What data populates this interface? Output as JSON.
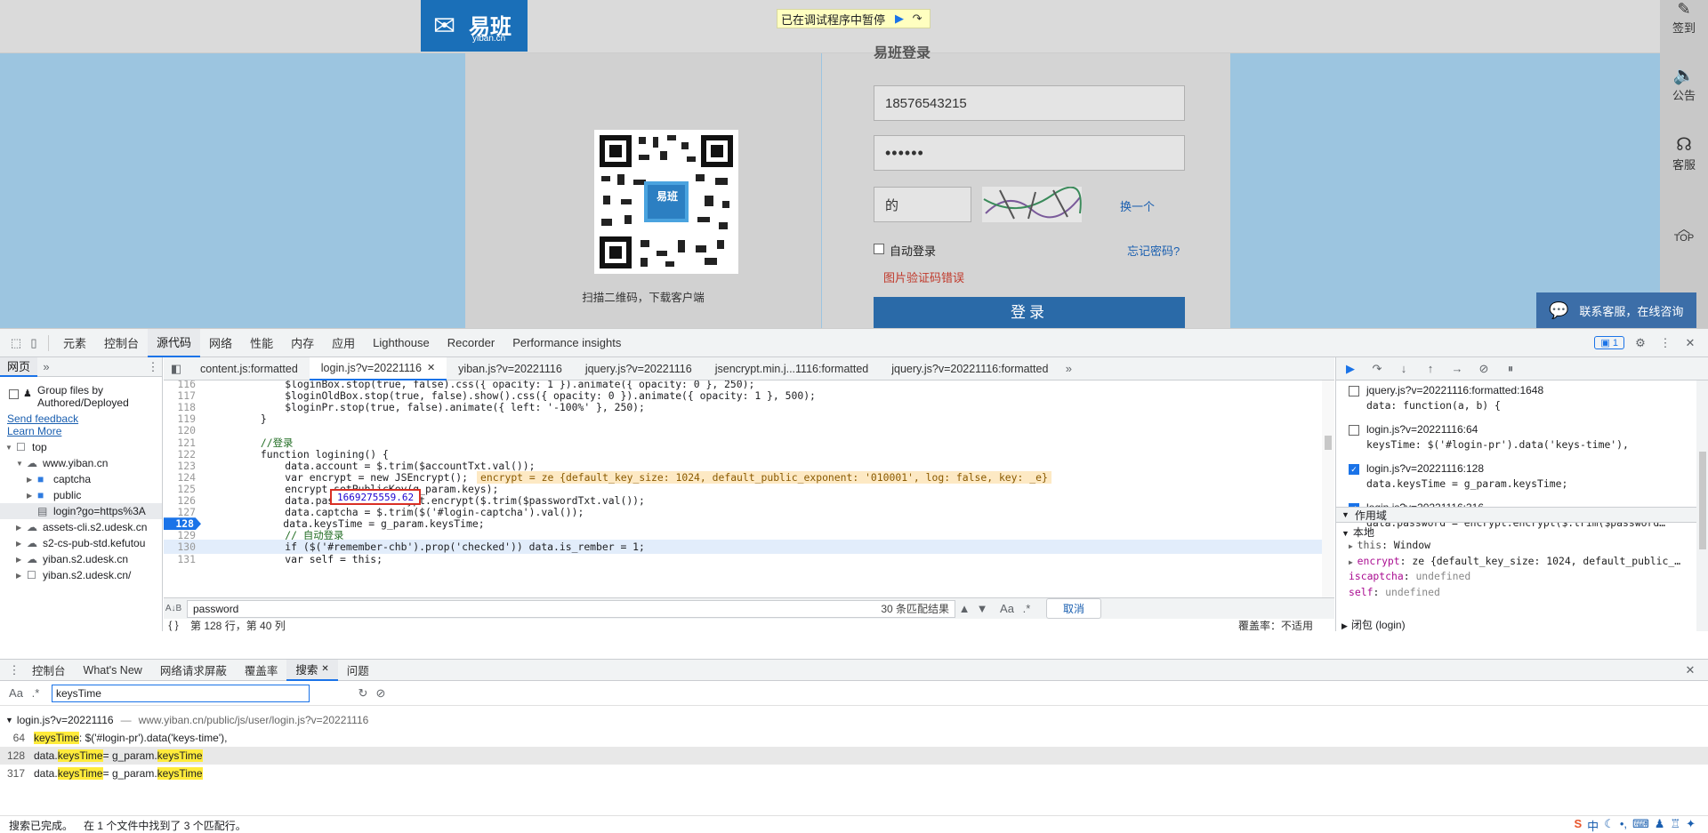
{
  "page": {
    "logo_text": "易班",
    "logo_subtext": "yiban.cn",
    "pause_banner": "已在调试程序中暂停",
    "heading_partial": "易班登录",
    "qr_caption": "扫描二维码，下载客户端",
    "qr_badge": "易班",
    "phone_value": "18576543215",
    "password_value": "••••••",
    "captcha_value": "的",
    "captcha_refresh": "换一个",
    "remember_label": "自动登录",
    "forgot_link": "忘记密码?",
    "error_text": "图片验证码错误",
    "login_button": "登录",
    "rail": {
      "signin": "签到",
      "announce": "公告",
      "service": "客服",
      "top": "TOP"
    },
    "chat_widget": "联系客服，在线咨询"
  },
  "devtools": {
    "main_tabs": [
      "元素",
      "控制台",
      "源代码",
      "网络",
      "性能",
      "内存",
      "应用",
      "Lighthouse",
      "Recorder",
      "Performance insights"
    ],
    "active_main_tab": "源代码",
    "issues_count": "1",
    "nav_tabs": {
      "page": "网页"
    },
    "nav_group_label": "Group files by Authored/Deployed",
    "send_feedback": "Send feedback",
    "learn_more": "Learn More",
    "tree": [
      {
        "label": "top",
        "indent": 0,
        "icon": "frame"
      },
      {
        "label": "www.yiban.cn",
        "indent": 1,
        "icon": "cloud"
      },
      {
        "label": "captcha",
        "indent": 2,
        "icon": "folder"
      },
      {
        "label": "public",
        "indent": 2,
        "icon": "folder"
      },
      {
        "label": "login?go=https%3A",
        "indent": 2,
        "icon": "file"
      },
      {
        "label": "assets-cli.s2.udesk.cn",
        "indent": 1,
        "icon": "cloud"
      },
      {
        "label": "s2-cs-pub-std.kefutou",
        "indent": 1,
        "icon": "cloud"
      },
      {
        "label": "yiban.s2.udesk.cn",
        "indent": 1,
        "icon": "cloud"
      },
      {
        "label": "yiban.s2.udesk.cn/",
        "indent": 1,
        "icon": "frame"
      }
    ],
    "file_tabs": [
      "content.js:formatted",
      "login.js?v=20221116",
      "yiban.js?v=20221116",
      "jquery.js?v=20221116",
      "jsencrypt.min.j...1116:formatted",
      "jquery.js?v=20221116:formatted"
    ],
    "active_file_tab": "login.js?v=20221116",
    "code_lines": [
      {
        "n": "116",
        "t": "            $loginBox.stop(true, false).css({ opacity: 1 }).animate({ opacity: 0 }, 250);"
      },
      {
        "n": "117",
        "t": "            $loginOldBox.stop(true, false).show().css({ opacity: 0 }).animate({ opacity: 1 }, 500);"
      },
      {
        "n": "118",
        "t": "            $loginPr.stop(true, false).animate({ left: '-100%' }, 250);"
      },
      {
        "n": "119",
        "t": "        }"
      },
      {
        "n": "120",
        "t": ""
      },
      {
        "n": "121",
        "t": "        //登录"
      },
      {
        "n": "122",
        "t": "        function logining() {"
      },
      {
        "n": "123",
        "t": "            data.account = $.trim($accountTxt.val());"
      },
      {
        "n": "124",
        "t": "            var encrypt = new JSEncrypt();"
      },
      {
        "n": "125",
        "t": "            encrypt.setPublicKey(g_param.keys);"
      },
      {
        "n": "126",
        "t": "            data.password = encrypt.encrypt($.trim($passwordTxt.val());"
      },
      {
        "n": "127",
        "t": "            data.captcha = $.trim($('#login-captcha').val());"
      },
      {
        "n": "128",
        "t": "            data.keysTime = g_param.keysTime;"
      },
      {
        "n": "129",
        "t": "            // 自动登录"
      },
      {
        "n": "130",
        "t": "            if ($('#remember-chb').prop('checked')) data.is_rember = 1;"
      },
      {
        "n": "131",
        "t": "            var self = this;"
      }
    ],
    "inline_value_124": "encrypt = ze {default_key_size: 1024, default_public_exponent: '010001', log: false, key: _e}",
    "hover_value": "1669275559.62",
    "search_query": "password",
    "search_count": "30 条匹配结果",
    "search_cancel": "取消",
    "cursor_pos": "第 128 行，第 40 列",
    "coverage": "覆盖率：不适用",
    "breakpoints": [
      {
        "file": "jquery.js?v=20221116:formatted:1648",
        "code": "data: function(a, b) {",
        "checked": false
      },
      {
        "file": "login.js?v=20221116:64",
        "code": "keysTime: $('#login-pr').data('keys-time'),",
        "checked": false
      },
      {
        "file": "login.js?v=20221116:128",
        "code": "data.keysTime = g_param.keysTime;",
        "checked": true
      },
      {
        "file": "login.js?v=20221116:316",
        "code": "data.password = encrypt.encrypt($.trim($password…",
        "checked": true
      }
    ],
    "scope_header": "作用域",
    "scope_local": "本地",
    "scope_vars": [
      {
        "k": "this",
        "v": "Window"
      },
      {
        "k": "encrypt",
        "v": "ze {default_key_size: 1024, default_public_…"
      },
      {
        "k": "iscaptcha",
        "v": "undefined"
      },
      {
        "k": "self",
        "v": "undefined"
      }
    ],
    "scope_closure": "闭包 (login)",
    "drawer_tabs": [
      "控制台",
      "What's New",
      "网络请求屏蔽",
      "覆盖率",
      "搜索",
      "问题"
    ],
    "active_drawer_tab": "搜索",
    "drawer_query": "keysTime",
    "result_file": "login.js?v=20221116",
    "result_path": "www.yiban.cn/public/js/user/login.js?v=20221116",
    "results": [
      {
        "n": "64",
        "pre": "",
        "mid": "keysTime",
        "post": ": $('#login-pr').data('keys-time'),"
      },
      {
        "n": "128",
        "pre": "data.",
        "mid": "keysTime",
        "post": " = g_param.",
        "mid2": "keysTime"
      },
      {
        "n": "317",
        "pre": "data.",
        "mid": "keysTime",
        "post": " = g_param.",
        "mid2": "keysTime"
      }
    ],
    "status_done": "搜索已完成。",
    "status_summary": "在 1 个文件中找到了 3 个匹配行。"
  },
  "colors": {
    "accent": "#1a73e8",
    "highlight": "#ffeb3b",
    "error": "#d93025",
    "login_button": "#2a6aa8"
  }
}
